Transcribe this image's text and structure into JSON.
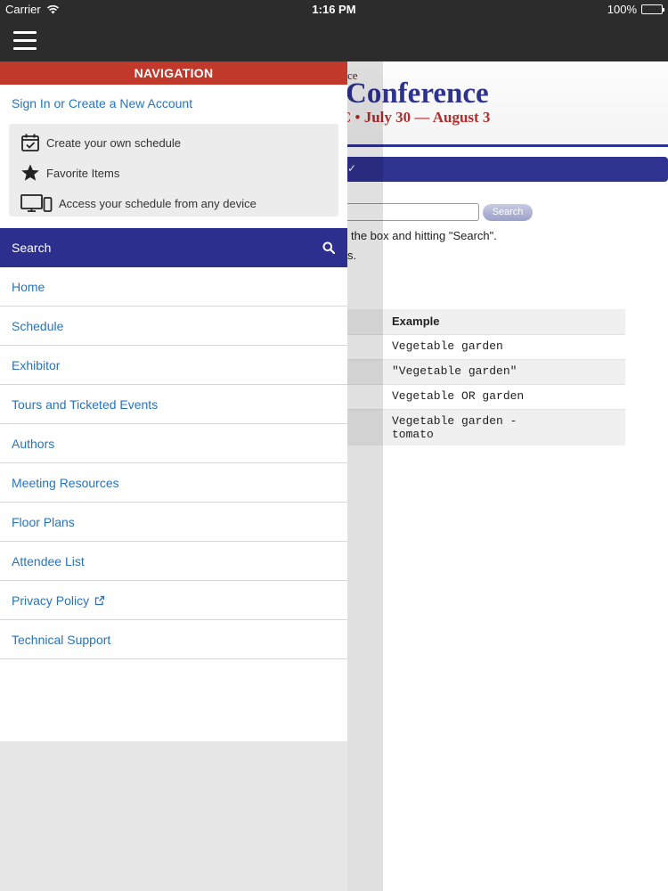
{
  "status_bar": {
    "carrier": "Carrier",
    "time": "1:16 PM",
    "battery": "100%"
  },
  "header": {
    "menu_icon": "hamburger-icon"
  },
  "background_page": {
    "banner_small": "ce",
    "banner_title": "Conference",
    "banner_dates": "C • July 30 — August 3",
    "search_button": "Search",
    "instruction_text": "the box and hitting \"Search\".",
    "instruction_text2": "s.",
    "table": {
      "header": "Example",
      "rows": [
        "Vegetable garden",
        "\"Vegetable garden\"",
        "Vegetable OR garden",
        "Vegetable garden -\ntomato"
      ]
    },
    "colors": {
      "brand_blue": "#2f3390",
      "brand_red": "#b22d2d"
    }
  },
  "drawer": {
    "title": "NAVIGATION",
    "sign_in": "Sign In or Create a New Account",
    "features": [
      {
        "icon": "calendar-check-icon",
        "label": "Create your own schedule"
      },
      {
        "icon": "star-icon",
        "label": "Favorite Items"
      },
      {
        "icon": "devices-icon",
        "label": "Access your schedule from any device"
      }
    ],
    "search_label": "Search",
    "items": [
      {
        "label": "Home"
      },
      {
        "label": "Schedule"
      },
      {
        "label": "Exhibitor"
      },
      {
        "label": "Tours and Ticketed Events"
      },
      {
        "label": "Authors"
      },
      {
        "label": "Meeting Resources"
      },
      {
        "label": "Floor Plans"
      },
      {
        "label": "Attendee List"
      },
      {
        "label": "Privacy Policy",
        "icon": "external-link-icon"
      },
      {
        "label": "Technical Support"
      }
    ],
    "colors": {
      "header_red": "#c0392b",
      "search_blue": "#2d2f8f",
      "link_blue": "#2a73b8"
    }
  }
}
